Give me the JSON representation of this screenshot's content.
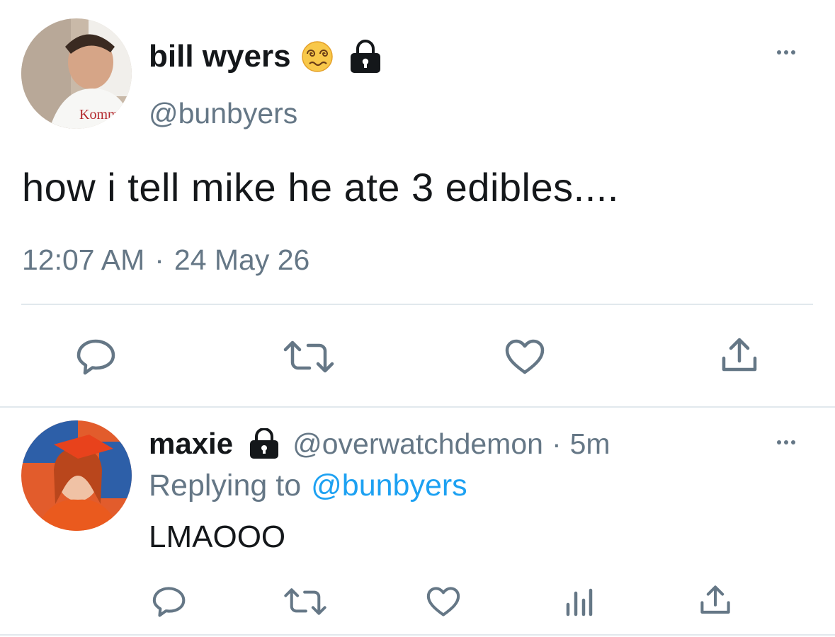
{
  "main_tweet": {
    "display_name": "bill wyers",
    "emoji": "😵‍💫",
    "handle": "@bunbyers",
    "text": "how i tell mike he ate 3 edibles....",
    "time": "12:07 AM",
    "separator": "·",
    "date": "24 May 26",
    "avatar_icon": "user-photo",
    "lock_icon": "lock-icon"
  },
  "reply": {
    "display_name": "maxie",
    "handle": "@overwatchdemon",
    "separator": "·",
    "age": "5m",
    "replying_prefix": "Replying to",
    "replying_handle": "@bunbyers",
    "text": "LMAOOO",
    "avatar_icon": "user-photo"
  },
  "colors": {
    "text": "#14171a",
    "muted": "#657786",
    "link": "#1da1f2",
    "divider": "#e1e8ed"
  }
}
